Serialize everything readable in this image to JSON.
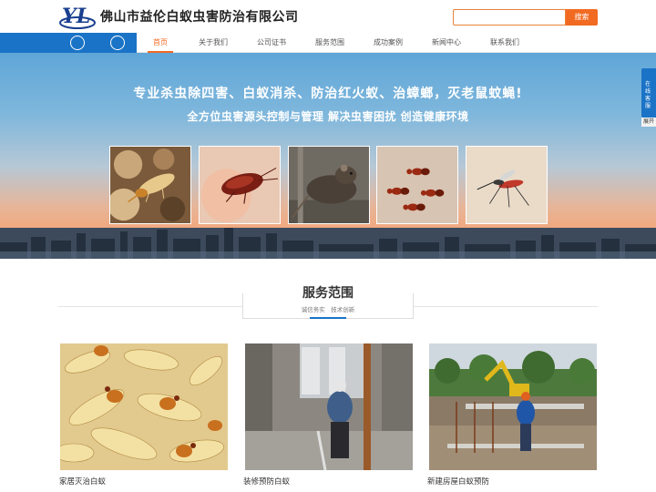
{
  "header": {
    "logo_text": "YL",
    "site_title": "佛山市益伦白蚁虫害防治有限公司",
    "search_placeholder": "",
    "search_button": "搜索"
  },
  "nav": {
    "items": [
      {
        "label": "首页",
        "active": true
      },
      {
        "label": "关于我们",
        "active": false
      },
      {
        "label": "公司证书",
        "active": false
      },
      {
        "label": "服务范围",
        "active": false
      },
      {
        "label": "成功案例",
        "active": false
      },
      {
        "label": "新闻中心",
        "active": false
      },
      {
        "label": "联系我们",
        "active": false
      }
    ]
  },
  "banner": {
    "line1": "专业杀虫除四害、白蚁消杀、防治红火蚁、治蟑螂，灭老鼠蚊蝇!",
    "line2": "全方位虫害源头控制与管理 解决虫害困扰 创造健康环境",
    "pests": [
      "termite",
      "cockroach",
      "rat",
      "fire-ant",
      "mosquito"
    ]
  },
  "side_float": {
    "text": "在线客服",
    "close": "展开"
  },
  "services": {
    "title": "服务范围",
    "subtitle": "诚信务实　技术创新",
    "cards": [
      {
        "label": "家居灭治白蚁"
      },
      {
        "label": "装修预防白蚁"
      },
      {
        "label": "新建房屋白蚁预防"
      }
    ]
  },
  "colors": {
    "brand_blue": "#1a73c6",
    "accent_orange": "#f26a21"
  }
}
